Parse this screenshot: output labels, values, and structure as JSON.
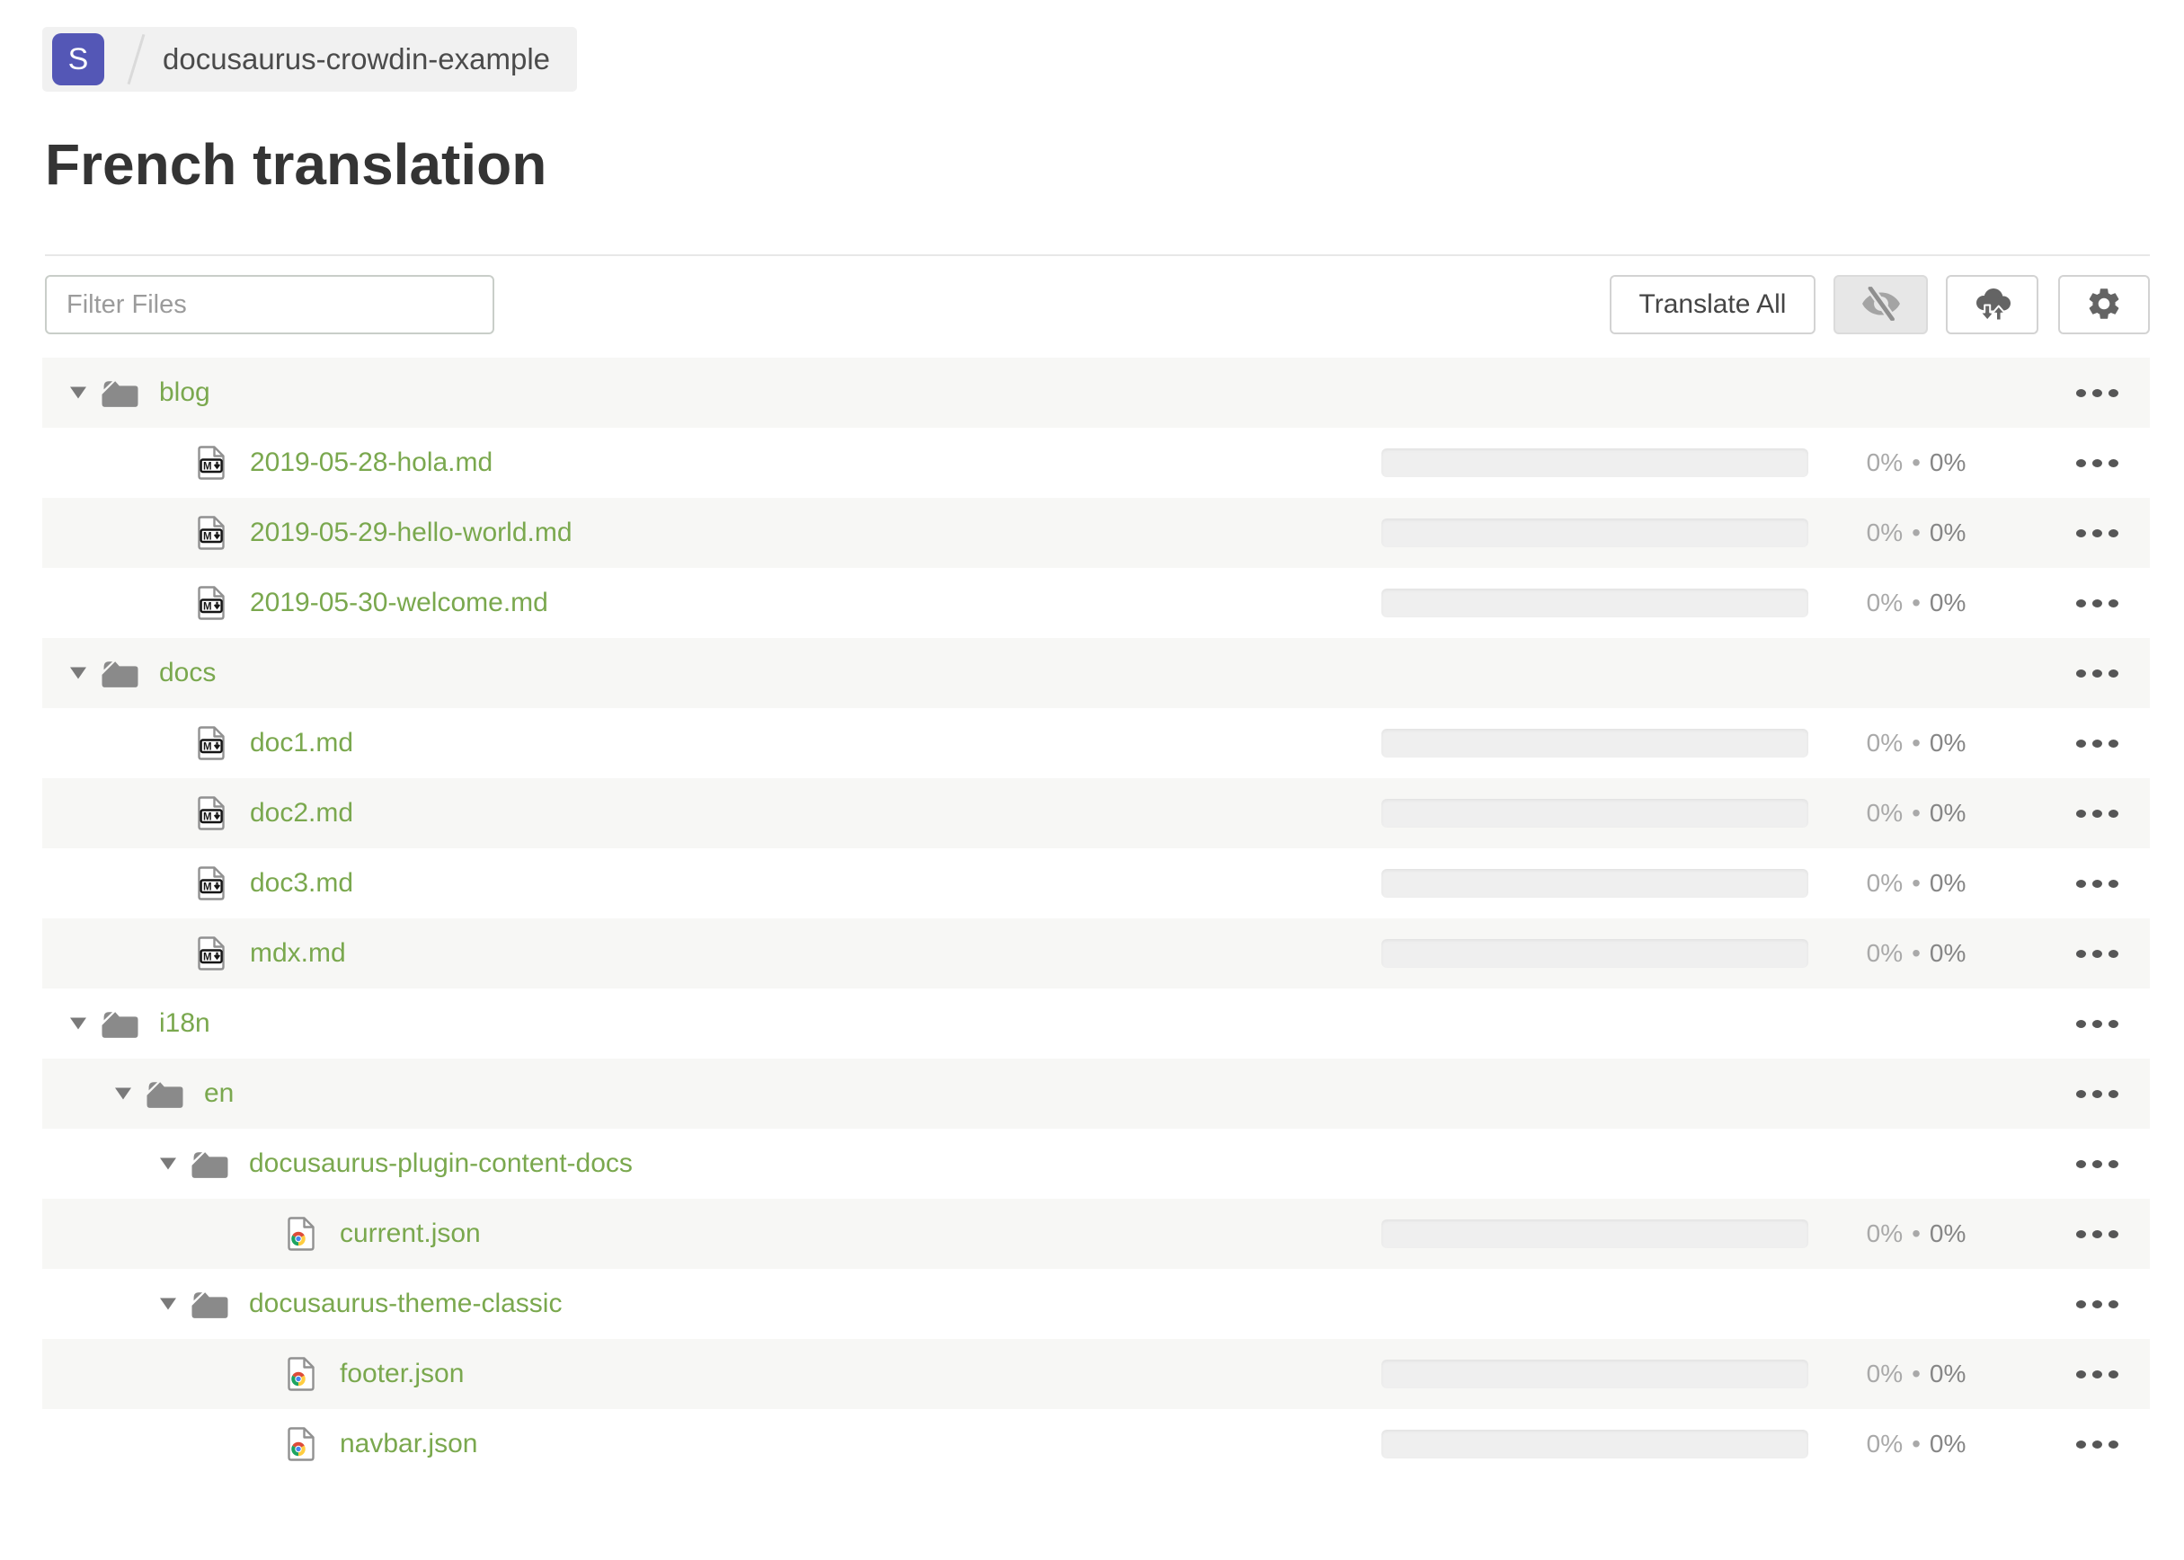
{
  "breadcrumb": {
    "org_initial": "S",
    "project_name": "docusaurus-crowdin-example"
  },
  "page": {
    "title": "French translation"
  },
  "toolbar": {
    "filter_placeholder": "Filter Files",
    "translate_all_label": "Translate All",
    "icon_buttons": [
      {
        "name": "toggle-hidden-files",
        "icon": "eye-off-icon",
        "active": true
      },
      {
        "name": "sync-files",
        "icon": "cloud-sync-icon",
        "active": false
      },
      {
        "name": "settings",
        "icon": "gear-icon",
        "active": false
      }
    ]
  },
  "tree": {
    "percent_separator": "•",
    "row_menu_icon": "ellipsis-icon",
    "collapse_icon": "triangle-down-icon",
    "rows": [
      {
        "type": "folder",
        "name": "blog",
        "depth": 0,
        "expanded": true
      },
      {
        "type": "file",
        "kind": "markdown",
        "name": "2019-05-28-hola.md",
        "depth": 1,
        "translated": "0%",
        "approved": "0%",
        "bar_fill": 0
      },
      {
        "type": "file",
        "kind": "markdown",
        "name": "2019-05-29-hello-world.md",
        "depth": 1,
        "translated": "0%",
        "approved": "0%",
        "bar_fill": 0
      },
      {
        "type": "file",
        "kind": "markdown",
        "name": "2019-05-30-welcome.md",
        "depth": 1,
        "translated": "0%",
        "approved": "0%",
        "bar_fill": 0
      },
      {
        "type": "folder",
        "name": "docs",
        "depth": 0,
        "expanded": true
      },
      {
        "type": "file",
        "kind": "markdown",
        "name": "doc1.md",
        "depth": 1,
        "translated": "0%",
        "approved": "0%",
        "bar_fill": 0
      },
      {
        "type": "file",
        "kind": "markdown",
        "name": "doc2.md",
        "depth": 1,
        "translated": "0%",
        "approved": "0%",
        "bar_fill": 0
      },
      {
        "type": "file",
        "kind": "markdown",
        "name": "doc3.md",
        "depth": 1,
        "translated": "0%",
        "approved": "0%",
        "bar_fill": 0
      },
      {
        "type": "file",
        "kind": "markdown",
        "name": "mdx.md",
        "depth": 1,
        "translated": "0%",
        "approved": "0%",
        "bar_fill": 0
      },
      {
        "type": "folder",
        "name": "i18n",
        "depth": 0,
        "expanded": true
      },
      {
        "type": "folder",
        "name": "en",
        "depth": 1,
        "expanded": true
      },
      {
        "type": "folder",
        "name": "docusaurus-plugin-content-docs",
        "depth": 2,
        "expanded": true
      },
      {
        "type": "file",
        "kind": "json",
        "name": "current.json",
        "depth": 3,
        "translated": "0%",
        "approved": "0%",
        "bar_fill": 0
      },
      {
        "type": "folder",
        "name": "docusaurus-theme-classic",
        "depth": 2,
        "expanded": true
      },
      {
        "type": "file",
        "kind": "json",
        "name": "footer.json",
        "depth": 3,
        "translated": "0%",
        "approved": "0%",
        "bar_fill": 0
      },
      {
        "type": "file",
        "kind": "json",
        "name": "navbar.json",
        "depth": 3,
        "translated": "0%",
        "approved": "0%",
        "bar_fill": 0
      }
    ]
  },
  "colors": {
    "accent_green": "#7aa84e",
    "badge_purple": "#5457b6",
    "row_stripe": "#f7f7f5",
    "breadcrumb_bg": "#f1f1f1",
    "icon_gray": "#8a8a8a",
    "percent_light": "#a9a9a9",
    "percent_dark": "#868686",
    "active_button_bg": "#e7e7e7"
  }
}
